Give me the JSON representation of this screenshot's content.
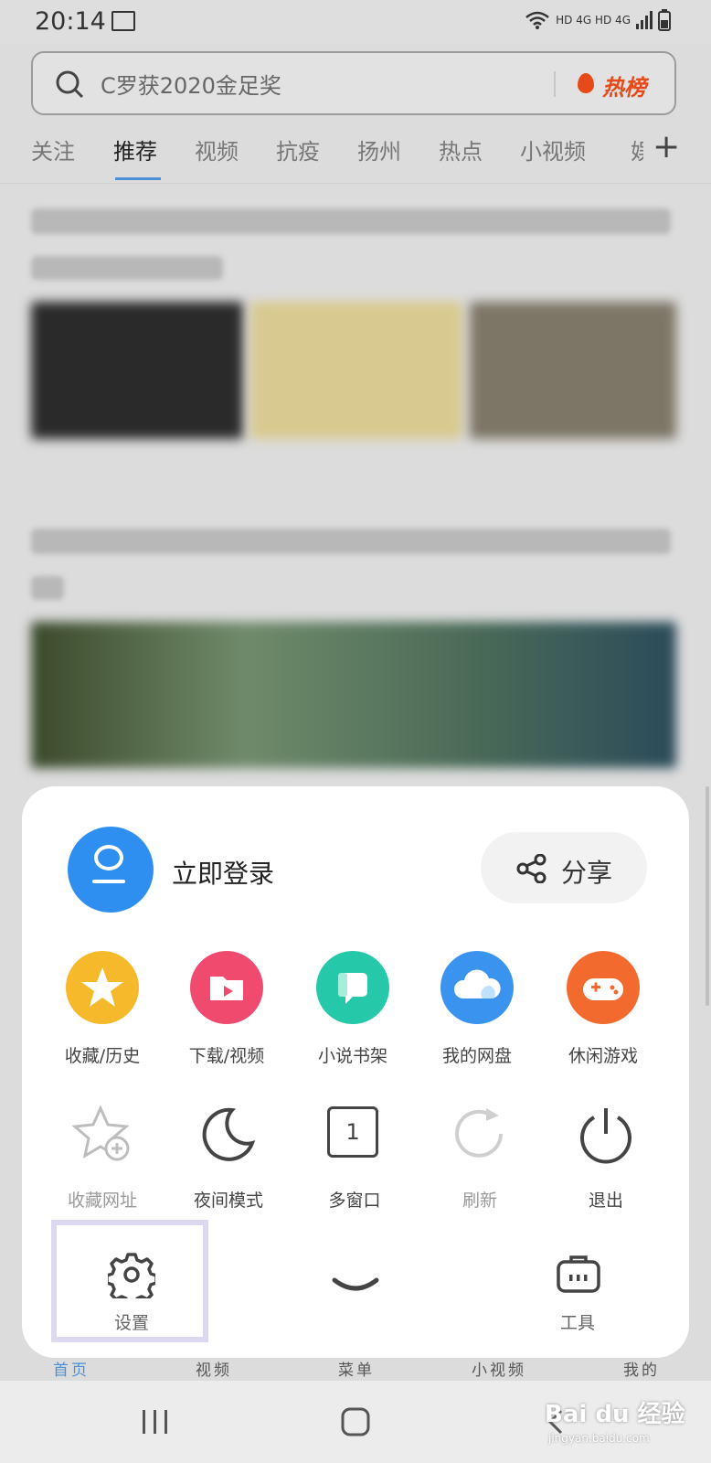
{
  "status_bar": {
    "time": "20:14",
    "network": "HD 4G HD 4G"
  },
  "search": {
    "query": "C罗获2020金足奖",
    "hot_label": "热榜"
  },
  "tabs": [
    {
      "label": "关注"
    },
    {
      "label": "推荐"
    },
    {
      "label": "视频"
    },
    {
      "label": "抗疫"
    },
    {
      "label": "扬州"
    },
    {
      "label": "热点"
    },
    {
      "label": "小视频"
    },
    {
      "label": "娱"
    }
  ],
  "tab_add_label": "+",
  "sheet": {
    "login_label": "立即登录",
    "share_label": "分享",
    "apps": [
      {
        "label": "收藏/历史",
        "color": "#f6b92b"
      },
      {
        "label": "下载/视频",
        "color": "#f04a6f"
      },
      {
        "label": "小说书架",
        "color": "#25c8a8"
      },
      {
        "label": "我的网盘",
        "color": "#3b93f0"
      },
      {
        "label": "休闲游戏",
        "color": "#f26a2e"
      }
    ],
    "tools": [
      {
        "label": "收藏网址",
        "enabled": false
      },
      {
        "label": "夜间模式",
        "enabled": true
      },
      {
        "label": "多窗口",
        "enabled": true,
        "count": "1"
      },
      {
        "label": "刷新",
        "enabled": false
      },
      {
        "label": "退出",
        "enabled": true
      }
    ],
    "bottom": {
      "settings_label": "设置",
      "tools_label": "工具"
    }
  },
  "bottom_nav": [
    {
      "label": "首页"
    },
    {
      "label": "视频"
    },
    {
      "label": "菜单"
    },
    {
      "label": "小视频"
    },
    {
      "label": "我的"
    }
  ],
  "watermark": {
    "brand": "Bai du 经验",
    "site": "jingyan.baidu.com"
  },
  "colors": {
    "accent": "#4a90d6",
    "avatar": "#2f8ff0",
    "hot": "#e64a19"
  }
}
